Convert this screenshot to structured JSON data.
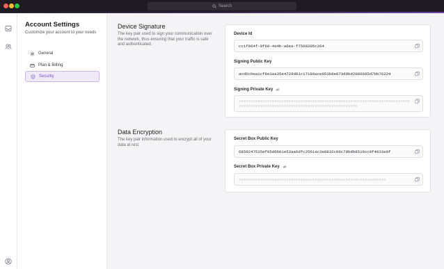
{
  "titlebar": {
    "search_placeholder": "Search"
  },
  "rail": {
    "icons": [
      "inbox-icon",
      "users-icon",
      "account-icon"
    ]
  },
  "nav": {
    "title": "Account Settings",
    "subtitle": "Customize your account to your needs",
    "items": [
      {
        "label": "General",
        "icon": "gear-icon",
        "active": false
      },
      {
        "label": "Plan & Billing",
        "icon": "card-icon",
        "active": false
      },
      {
        "label": "Security",
        "icon": "shield-icon",
        "active": true
      }
    ]
  },
  "signature": {
    "title": "Device Signature",
    "description": "The key pair used to sign your communication over the network, thus ensuring that your traffic is safe and authenticated.",
    "device_id_label": "Device Id",
    "device_id_value": "cc1f064f-9f60-4e4b-a6ea-f7568205c264",
    "public_key_label": "Signing Public Key",
    "public_key_value": "acd6cbea1cf8e3aa35e4728d81c17189ace053b8e073d9bd2086685d7bb76224",
    "private_key_label": "Signing Private Key",
    "private_key_value": "xxxxxxxxxxxxxxxxxxxxxxxxxxxxxxxxxxxxxxxxxxxxxxxxxxxxxxxxxxxxxxxxxxxxxxxxxxxxxxxxxxxxxxxxxxxxxxxxxxxxxxxxxxxxxxxxxxxxxxxxxx"
  },
  "encryption": {
    "title": "Data Encryption",
    "description": "The key pair information used to encrypt all of your data at rest.",
    "public_key_label": "Secret Box Public Key",
    "public_key_value": "6859247535ef05d6601e53aa6dfc2561ac3e8832c86c79bdb8516cc0f4033e0f",
    "private_key_label": "Secret Box Private Key",
    "private_key_value": "xxxxxxxxxxxxxxxxxxxxxxxxxxxxxxxxxxxxxxxxxxxxxxxxxxxxxxxxxxxxxx"
  }
}
